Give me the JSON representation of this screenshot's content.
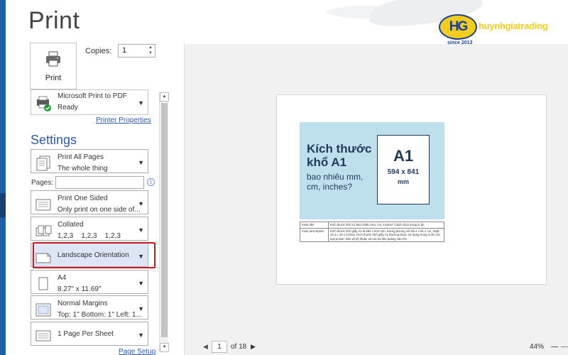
{
  "title": "Print",
  "print_button": {
    "label": "Print",
    "icon": "printer-icon"
  },
  "copies": {
    "label": "Copies:",
    "value": "1"
  },
  "printer": {
    "name": "Microsoft Print to PDF",
    "status": "Ready",
    "properties_link": "Printer Properties"
  },
  "settings_heading": "Settings",
  "settings": [
    {
      "id": "print-range",
      "line1": "Print All Pages",
      "line2": "The whole thing"
    },
    {
      "id": "sides",
      "line1": "Print One Sided",
      "line2": "Only print on one side of..."
    },
    {
      "id": "collation",
      "line1": "Collated",
      "line2": "1,2,3    1,2,3    1,2,3"
    },
    {
      "id": "orientation",
      "line1": "Landscape Orientation",
      "line2": ""
    },
    {
      "id": "paper-size",
      "line1": "A4",
      "line2": "8.27\" x 11.69\""
    },
    {
      "id": "margins",
      "line1": "Normal Margins",
      "line2": "Top: 1\" Bottom: 1\" Left: 1..."
    },
    {
      "id": "pages-per-sheet",
      "line1": "1 Page Per Sheet",
      "line2": ""
    }
  ],
  "pages_field": {
    "label": "Pages:",
    "value": "",
    "info_icon": "i"
  },
  "page_setup_link": "Page Setup",
  "preview": {
    "heading_line1": "Kích thước",
    "heading_line2": "khổ A1",
    "sub_line1": "bao nhiêu mm,",
    "sub_line2": "cm, inches?",
    "card_title": "A1",
    "card_dims": "594 x 841",
    "card_unit": "mm",
    "table": [
      {
        "key": "meta title",
        "value": "Kích thước khổ A1 bao nhiêu mm, cm, inches? Cách chọn trong in ấn"
      },
      {
        "key": "meta description",
        "value": "Kích thước khổ giấy A1 là 594 x 841 mm, tương đương với 59.4 x 84.1 cm, hoặc 23.4 x 33.1 inches. Kích thước khổ giấy A1 thường được sử dụng trong in ấn các loại poster, bản vẽ kỹ thuật, và các tài liệu quảng cáo lớn"
      }
    ]
  },
  "navigation": {
    "current_page": "1",
    "of_label": "of 18",
    "prev_arrow": "◀",
    "next_arrow": "▶"
  },
  "zoom": {
    "level": "44%"
  },
  "watermark": {
    "name": "huynhgiatrading",
    "since": "since 2013",
    "monogram": "HG"
  },
  "colors": {
    "accent": "#2a5caa",
    "highlight_border": "#d7141a",
    "selected_fill": "#dce6f6",
    "banner": "#bee0ec",
    "brand_yellow": "#f2cd1c",
    "brand_blue": "#1c3f8f"
  }
}
